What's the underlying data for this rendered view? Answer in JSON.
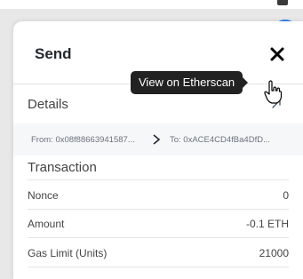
{
  "window": {
    "title": "Send"
  },
  "details": {
    "label": "Details",
    "tooltip": "View on Etherscan"
  },
  "addresses": {
    "from": "From: 0x08f88663941587...",
    "to": "To: 0xACE4CD4fBa4DfD..."
  },
  "transaction": {
    "title": "Transaction",
    "rows": [
      {
        "label": "Nonce",
        "value": "0"
      },
      {
        "label": "Amount",
        "value": "-0.1 ETH"
      },
      {
        "label": "Gas Limit (Units)",
        "value": "21000"
      }
    ]
  },
  "icons": {
    "close": "close-icon",
    "external_link": "external-link-icon",
    "arrow": "chevron-right-icon",
    "cursor": "hand-pointer-icon"
  },
  "colors": {
    "tooltip_bg": "#222222",
    "address_bar_bg": "#f6f7f8",
    "link_blue": "#037dd6"
  }
}
